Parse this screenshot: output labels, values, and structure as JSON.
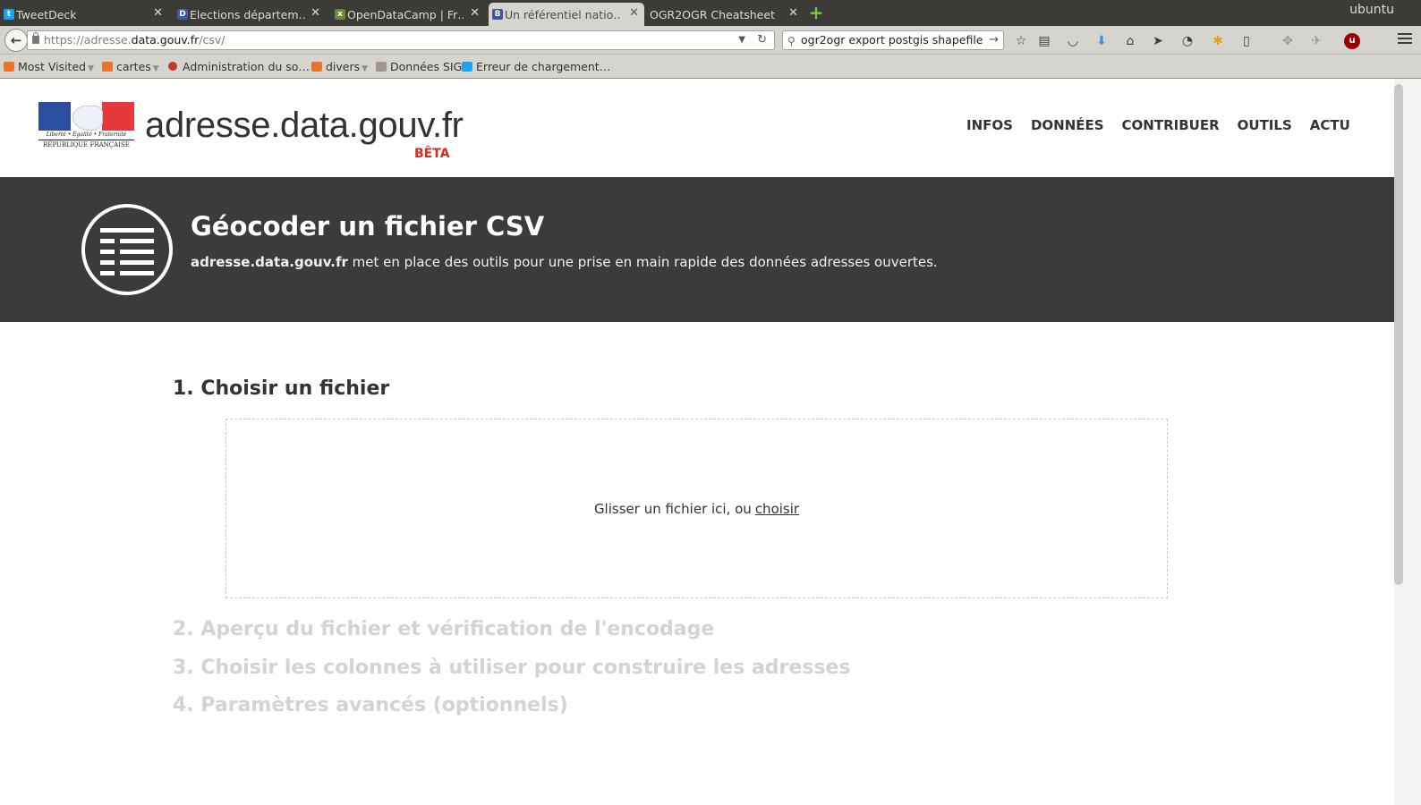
{
  "browser": {
    "os_label": "ubuntu",
    "tabs": [
      {
        "title": "TweetDeck",
        "favicon": "twitter-icon",
        "color": "#1da1f2"
      },
      {
        "title": "Elections départem…",
        "favicon": "d-icon",
        "color": "#3a5ba0"
      },
      {
        "title": "OpenDataCamp | Fr…",
        "favicon": "x-icon",
        "color": "#6a8a3a"
      },
      {
        "title": "Un référentiel natio…",
        "favicon": "ban-icon",
        "color": "#3a56a0"
      },
      {
        "title": "OGR2OGR Cheatsheet",
        "favicon": "",
        "color": ""
      }
    ],
    "url": {
      "scheme": "https://adresse.",
      "host": "data.gouv.fr",
      "path": "/csv/"
    },
    "search_value": "ogr2ogr export postgis shapefile",
    "bookmarks": [
      {
        "label": "Most Visited",
        "icon": "most-visited-icon",
        "color": "#e8742c",
        "dropdown": true
      },
      {
        "label": "cartes",
        "icon": "folder-icon",
        "color": "#e8742c",
        "dropdown": true
      },
      {
        "label": "Administration du so…",
        "icon": "admin-icon",
        "color": "#c0392b",
        "dropdown": false
      },
      {
        "label": "divers",
        "icon": "folder-icon",
        "color": "#e8742c",
        "dropdown": true
      },
      {
        "label": "Données SIG",
        "icon": "sig-icon",
        "color": "#888888",
        "dropdown": false
      },
      {
        "label": "Erreur de chargement…",
        "icon": "twitter-icon",
        "color": "#1da1f2",
        "dropdown": false
      }
    ]
  },
  "site": {
    "logo_motto": "Liberté • Égalité • Fraternité",
    "logo_republic": "RÉPUBLIQUE FRANÇAISE",
    "name": "adresse.data.gouv.fr",
    "beta": "BÊTA",
    "nav": [
      "INFOS",
      "DONNÉES",
      "CONTRIBUER",
      "OUTILS",
      "ACTU"
    ]
  },
  "hero": {
    "title": "Géocoder un fichier CSV",
    "subtitle_strong": "adresse.data.gouv.fr",
    "subtitle_rest": " met en place des outils pour une prise en main rapide des données adresses ouvertes."
  },
  "steps": [
    {
      "label": "1. Choisir un fichier",
      "active": true
    },
    {
      "label": "2. Aperçu du fichier et vérification de l'encodage",
      "active": false
    },
    {
      "label": "3. Choisir les colonnes à utiliser pour construire les adresses",
      "active": false
    },
    {
      "label": "4. Paramètres avancés (optionnels)",
      "active": false
    }
  ],
  "dropzone": {
    "text": "Glisser un fichier ici, ou",
    "link": "choisir"
  }
}
